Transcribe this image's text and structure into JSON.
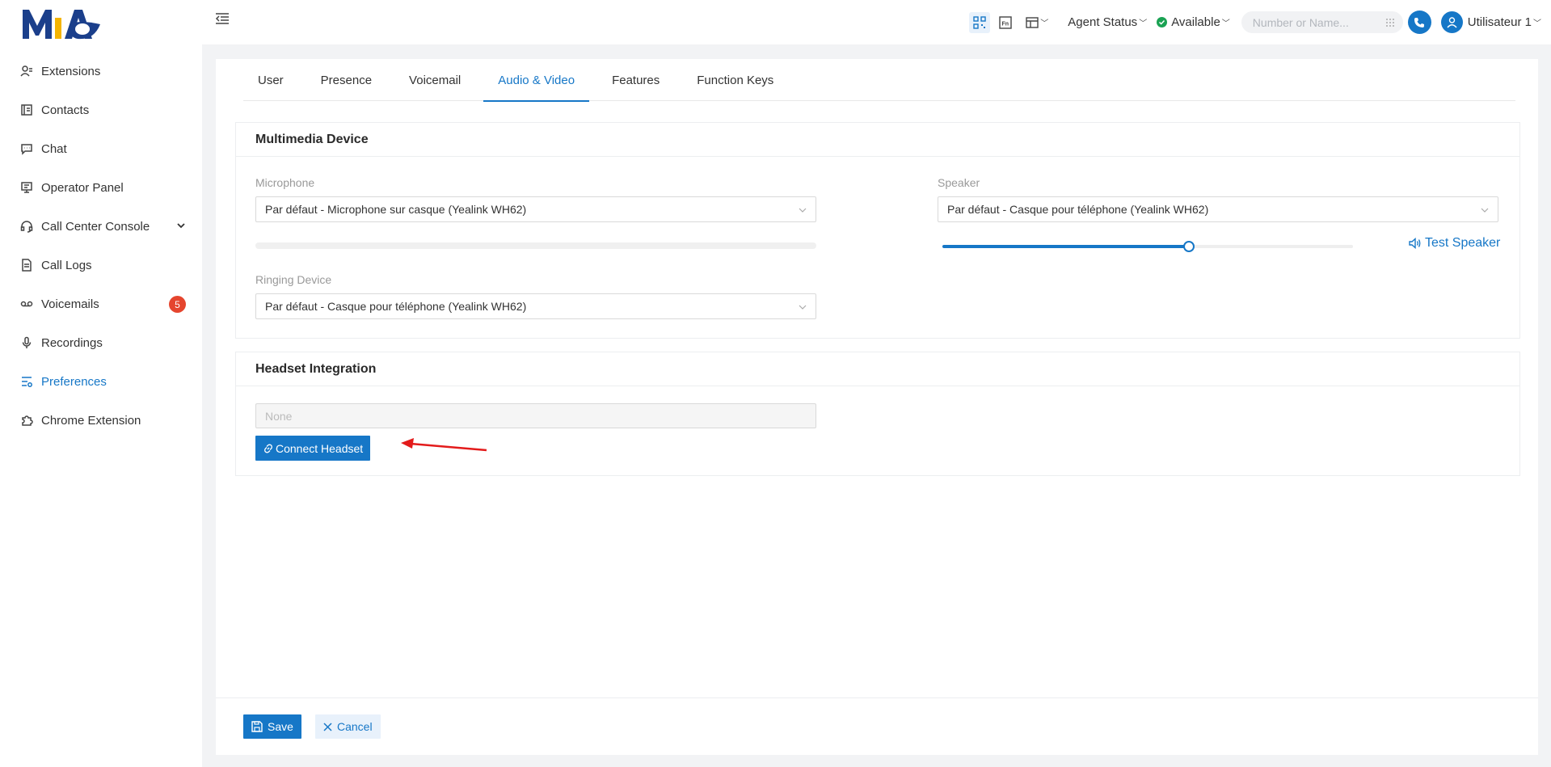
{
  "brand": {
    "logo_text": "MiA",
    "accent": "#1677c7",
    "logo_yellow": "#f4b400",
    "logo_blue": "#1b3f8b"
  },
  "sidebar": {
    "items": [
      {
        "label": "Extensions",
        "icon": "user-list-icon"
      },
      {
        "label": "Contacts",
        "icon": "contacts-book-icon"
      },
      {
        "label": "Chat",
        "icon": "chat-bubble-icon"
      },
      {
        "label": "Operator Panel",
        "icon": "monitor-panel-icon"
      },
      {
        "label": "Call Center Console",
        "icon": "headset-icon"
      },
      {
        "label": "Call Logs",
        "icon": "document-log-icon"
      },
      {
        "label": "Voicemails",
        "icon": "voicemail-icon",
        "badge": "5"
      },
      {
        "label": "Recordings",
        "icon": "microphone-icon"
      },
      {
        "label": "Preferences",
        "icon": "sliders-icon"
      },
      {
        "label": "Chrome Extension",
        "icon": "puzzle-icon"
      }
    ]
  },
  "header": {
    "agent_status": "Agent Status",
    "availability": "Available",
    "search_placeholder": "Number or Name...",
    "user_name": "Utilisateur 1"
  },
  "tabs": [
    "User",
    "Presence",
    "Voicemail",
    "Audio & Video",
    "Features",
    "Function Keys"
  ],
  "multimedia": {
    "title": "Multimedia Device",
    "microphone_label": "Microphone",
    "microphone_value": "Par défaut - Microphone sur casque (Yealink WH62)",
    "microphone_level": 0,
    "speaker_label": "Speaker",
    "speaker_value": "Par défaut - Casque pour téléphone (Yealink WH62)",
    "speaker_volume_percent": 60,
    "test_speaker": "Test Speaker",
    "ringing_label": "Ringing Device",
    "ringing_value": "Par défaut - Casque pour téléphone (Yealink WH62)"
  },
  "headset": {
    "title": "Headset Integration",
    "placeholder": "None",
    "connect_label": "Connect Headset"
  },
  "footer": {
    "save": "Save",
    "cancel": "Cancel"
  }
}
